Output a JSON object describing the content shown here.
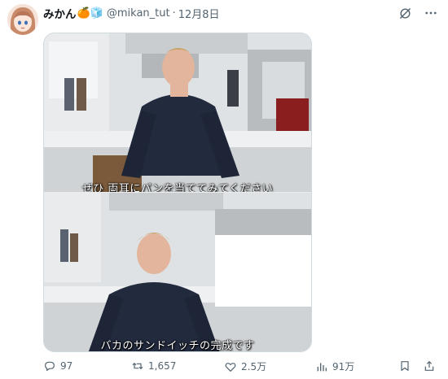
{
  "tweet": {
    "display_name": "みかん",
    "name_emojis": "🍊🧊",
    "handle": "@mikan_tut",
    "separator": "·",
    "date": "12月8日",
    "icons": [
      "grok-icon",
      "more-icon"
    ]
  },
  "media": {
    "frame1_subtitle": "ぜひ 両耳にパンを当ててみてください",
    "frame2_subtitle": "バカのサンドイッチの完成です"
  },
  "actions": {
    "replies": "97",
    "retweets": "1,657",
    "likes": "2.5万",
    "views": "91万"
  },
  "colors": {
    "text_secondary": "#536471",
    "border": "#cfd9de"
  }
}
